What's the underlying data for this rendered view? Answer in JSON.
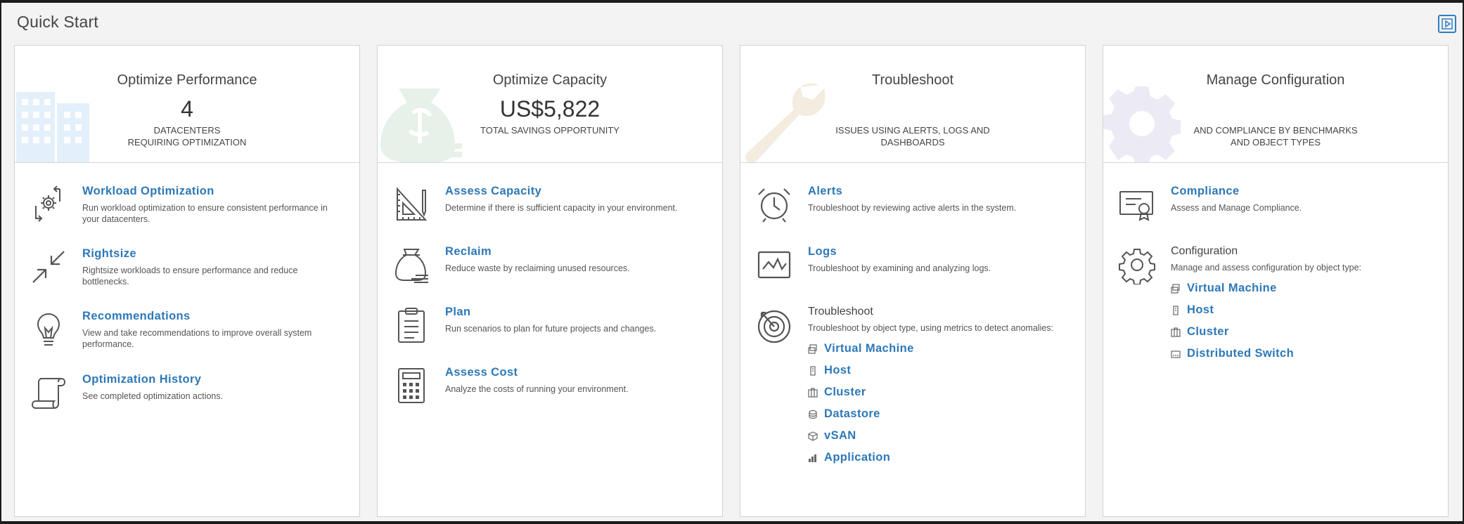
{
  "page": {
    "title": "Quick Start"
  },
  "cards": {
    "performance": {
      "title": "Optimize Performance",
      "value": "4",
      "subtitle_line1": "DATACENTERS",
      "subtitle_line2": "REQUIRING OPTIMIZATION",
      "items": [
        {
          "label": "Workload Optimization",
          "desc": "Run workload optimization to ensure consistent performance in your datacenters."
        },
        {
          "label": "Rightsize",
          "desc": "Rightsize workloads to ensure performance and reduce bottlenecks."
        },
        {
          "label": "Recommendations",
          "desc": "View and take recommendations to improve overall system performance."
        },
        {
          "label": "Optimization History",
          "desc": "See completed optimization actions."
        }
      ]
    },
    "capacity": {
      "title": "Optimize Capacity",
      "value": "US$5,822",
      "subtitle_line1": "TOTAL SAVINGS OPPORTUNITY",
      "items": [
        {
          "label": "Assess Capacity",
          "desc": "Determine if there is sufficient capacity in your environment."
        },
        {
          "label": "Reclaim",
          "desc": "Reduce waste by reclaiming unused resources."
        },
        {
          "label": "Plan",
          "desc": "Run scenarios to plan for future projects and changes."
        },
        {
          "label": "Assess Cost",
          "desc": "Analyze the costs of running your environment."
        }
      ]
    },
    "troubleshoot": {
      "title": "Troubleshoot",
      "subtitle_line1": "ISSUES USING ALERTS, LOGS AND",
      "subtitle_line2": "DASHBOARDS",
      "items": [
        {
          "label": "Alerts",
          "desc": "Troubleshoot by reviewing active alerts in the system."
        },
        {
          "label": "Logs",
          "desc": "Troubleshoot by examining and analyzing logs."
        },
        {
          "label": "Troubleshoot",
          "desc": "Troubleshoot by object type, using metrics to detect anomalies:"
        }
      ],
      "object_types": [
        "Virtual Machine",
        "Host",
        "Cluster",
        "Datastore",
        "vSAN",
        "Application"
      ]
    },
    "configuration": {
      "title": "Manage Configuration",
      "subtitle_line1": "AND COMPLIANCE BY BENCHMARKS",
      "subtitle_line2": "AND OBJECT TYPES",
      "items": [
        {
          "label": "Compliance",
          "desc": "Assess and Manage Compliance."
        },
        {
          "label": "Configuration",
          "desc": "Manage and assess configuration by object type:"
        }
      ],
      "object_types": [
        "Virtual Machine",
        "Host",
        "Cluster",
        "Distributed Switch"
      ]
    }
  },
  "colors": {
    "link": "#2d78b8",
    "accent": "#2f7dc2",
    "text": "#444444",
    "border": "#d2d2d2"
  }
}
